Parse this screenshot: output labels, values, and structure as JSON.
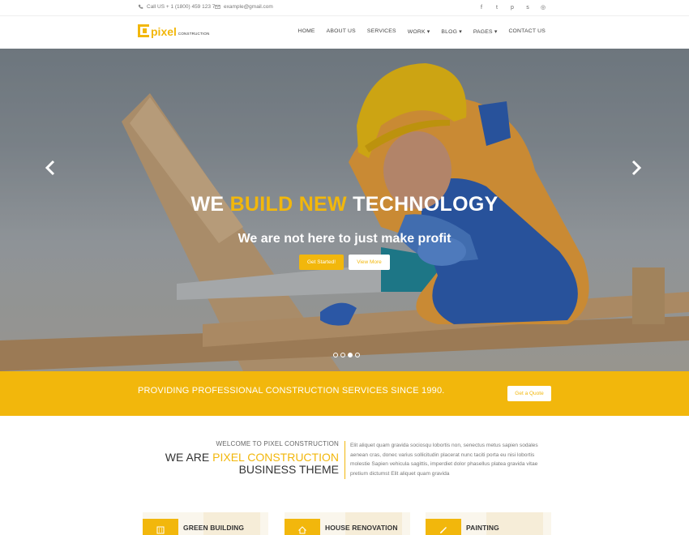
{
  "topbar": {
    "phone": "Call US + 1 (1800) 459 123 7",
    "email": "example@gmail.com",
    "socials": [
      "facebook-icon",
      "twitter-icon",
      "pinterest-icon",
      "skype-icon",
      "dribbble-icon"
    ],
    "social_glyphs": [
      "f",
      "t",
      "p",
      "s",
      "◎"
    ]
  },
  "logo": {
    "text": "pixel",
    "sub": "CONSTRUCTION"
  },
  "nav": {
    "items": [
      "HOME",
      "ABOUT US",
      "SERVICES",
      "WORK ▾",
      "BLOG ▾",
      "PAGES ▾",
      "CONTACT US"
    ]
  },
  "hero": {
    "title_pre": "WE ",
    "title_accent": "BUILD NEW",
    "title_post": " TECHNOLOGY",
    "subtitle": "We are not here to just make profit",
    "btn_primary": "Get Started!",
    "btn_secondary": "View More",
    "slides": 4,
    "active_slide": 3
  },
  "strip": {
    "text": "PROVIDING PROFESSIONAL CONSTRUCTION SERVICES SINCE 1990.",
    "button": "Get a Quote"
  },
  "welcome": {
    "kicker": "WELCOME TO PIXEL CONSTRUCTION",
    "head_pre": "WE ARE ",
    "head_accent": "PIXEL CONSTRUCTION",
    "head_line2": "BUSINESS THEME",
    "text": "Elit aliquet quam gravida sociosqu lobortis non, senectus metus sapien sodales aenean cras, donec varius sollicitudin placerat nunc taciti porta eu nisi lobortis molestie Sapien vehicula sagittis, imperdiet dolor phasellus platea gravida vitae pretium dictumst Elit aliquet quam gravida"
  },
  "services": [
    {
      "title": "GREEN BUILDING",
      "icon": "building-icon"
    },
    {
      "title": "HOUSE RENOVATION",
      "icon": "house-icon"
    },
    {
      "title": "PAINTING",
      "icon": "brush-icon"
    }
  ],
  "colors": {
    "accent": "#f2b70c",
    "text": "#333333"
  }
}
